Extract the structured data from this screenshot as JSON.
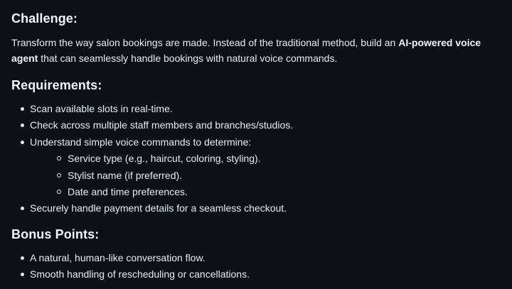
{
  "challenge": {
    "heading": "Challenge:",
    "text_before": "Transform the way salon bookings are made. Instead of the traditional method, build an ",
    "text_bold": "AI-powered voice agent",
    "text_after": " that can seamlessly handle bookings with natural voice commands."
  },
  "requirements": {
    "heading": "Requirements:",
    "items": [
      "Scan available slots in real-time.",
      "Check across multiple staff members and branches/studios.",
      "Understand simple voice commands to determine:",
      "Securely handle payment details for a seamless checkout."
    ],
    "subitems": [
      "Service type (e.g., haircut, coloring, styling).",
      "Stylist name (if preferred).",
      "Date and time preferences."
    ]
  },
  "bonus": {
    "heading": "Bonus Points:",
    "items": [
      "A natural, human-like conversation flow.",
      "Smooth handling of rescheduling or cancellations."
    ]
  }
}
